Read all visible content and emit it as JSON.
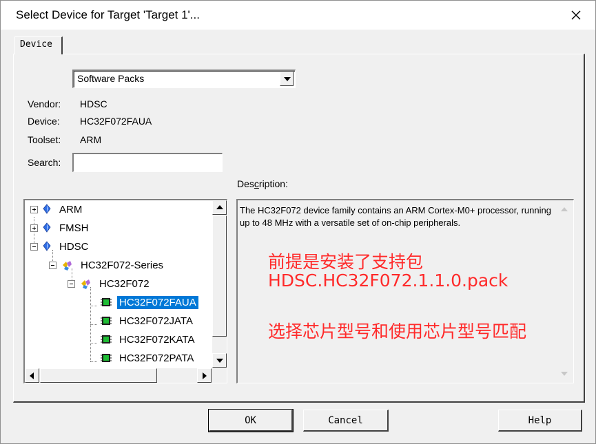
{
  "window": {
    "title": "Select Device for Target 'Target 1'..."
  },
  "tabs": [
    {
      "label": "Device"
    }
  ],
  "source_select": {
    "value": "Software Packs"
  },
  "info": {
    "vendor_label": "Vendor:",
    "vendor": "HDSC",
    "device_label": "Device:",
    "device": "HC32F072FAUA",
    "toolset_label": "Toolset:",
    "toolset": "ARM",
    "search_label": "Search:",
    "search_value": ""
  },
  "tree": {
    "nodes": [
      {
        "label": "ARM",
        "expander": "plus",
        "icon": "diamond-icon"
      },
      {
        "label": "FMSH",
        "expander": "plus",
        "icon": "diamond-icon"
      },
      {
        "label": "HDSC",
        "expander": "minus",
        "icon": "diamond-icon"
      },
      {
        "label": "HC32F072-Series",
        "expander": "minus",
        "icon": "series-icon"
      },
      {
        "label": "HC32F072",
        "expander": "minus",
        "icon": "series-icon"
      },
      {
        "label": "HC32F072FAUA",
        "icon": "chip-icon",
        "selected": true
      },
      {
        "label": "HC32F072JATA",
        "icon": "chip-icon"
      },
      {
        "label": "HC32F072KATA",
        "icon": "chip-icon"
      },
      {
        "label": "HC32F072PATA",
        "icon": "chip-icon"
      }
    ]
  },
  "description": {
    "label_pre": "Des",
    "label_u": "c",
    "label_post": "ription:",
    "text": "The HC32F072 device family contains an ARM Cortex-M0+ processor, running up to 48 MHz with a versatile set of on-chip peripherals."
  },
  "annotation": {
    "line1": "前提是安装了支持包",
    "line2": "HDSC.HC32F072.1.1.0.pack",
    "line3": "选择芯片型号和使用芯片型号匹配",
    "color": "#ff2a2a"
  },
  "buttons": {
    "ok": "OK",
    "cancel": "Cancel",
    "help": "Help"
  }
}
